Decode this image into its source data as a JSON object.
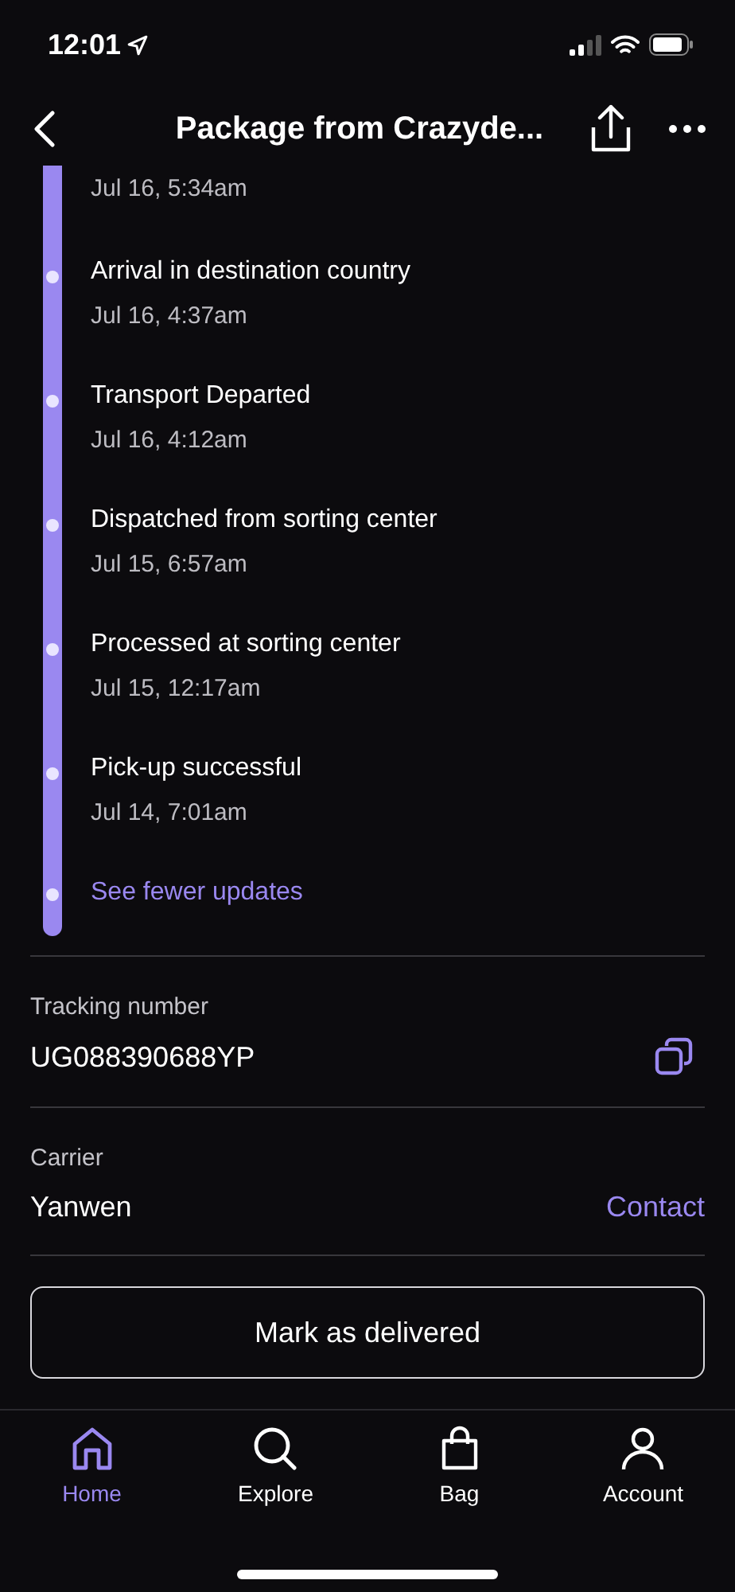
{
  "status_bar": {
    "time": "12:01"
  },
  "header": {
    "title": "Package from Crazyde..."
  },
  "timeline": {
    "events": [
      {
        "date": "Jul 16, 5:34am"
      },
      {
        "title": "Arrival in destination country",
        "date": "Jul 16, 4:37am"
      },
      {
        "title": "Transport Departed",
        "date": "Jul 16, 4:12am"
      },
      {
        "title": "Dispatched from sorting center",
        "date": "Jul 15, 6:57am"
      },
      {
        "title": "Processed at sorting center",
        "date": "Jul 15, 12:17am"
      },
      {
        "title": "Pick-up successful",
        "date": "Jul 14, 7:01am"
      }
    ],
    "toggle_link": "See fewer updates"
  },
  "tracking": {
    "label": "Tracking number",
    "value": "UG088390688YP"
  },
  "carrier": {
    "label": "Carrier",
    "value": "Yanwen",
    "action": "Contact"
  },
  "primary_button": "Mark as delivered",
  "tab_bar": [
    {
      "label": "Home",
      "selected": true
    },
    {
      "label": "Explore",
      "selected": false
    },
    {
      "label": "Bag",
      "selected": false
    },
    {
      "label": "Account",
      "selected": false
    }
  ]
}
